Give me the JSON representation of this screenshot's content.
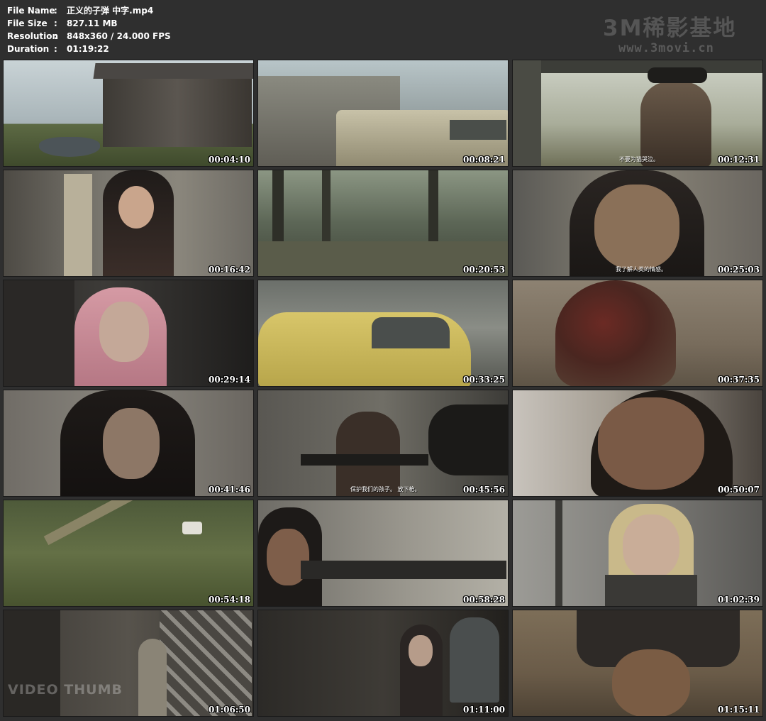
{
  "file_info": [
    {
      "label": "File Name",
      "value": "正义的子弹 中字.mp4"
    },
    {
      "label": "File Size",
      "value": "827.11 MB"
    },
    {
      "label": "Resolution",
      "value": "848x360 / 24.000 FPS"
    },
    {
      "label": "Duration",
      "value": "01:19:22"
    }
  ],
  "separator": ":",
  "watermark": {
    "title": "3M稀影基地",
    "url": "www.3movi.cn"
  },
  "thumbnails": [
    {
      "time": "00:04:10",
      "subtitle": ""
    },
    {
      "time": "00:08:21",
      "subtitle": ""
    },
    {
      "time": "00:12:31",
      "subtitle": "不要为猫哭泣。"
    },
    {
      "time": "00:16:42",
      "subtitle": ""
    },
    {
      "time": "00:20:53",
      "subtitle": ""
    },
    {
      "time": "00:25:03",
      "subtitle": "我了解人类的情感。"
    },
    {
      "time": "00:29:14",
      "subtitle": ""
    },
    {
      "time": "00:33:25",
      "subtitle": ""
    },
    {
      "time": "00:37:35",
      "subtitle": ""
    },
    {
      "time": "00:41:46",
      "subtitle": ""
    },
    {
      "time": "00:45:56",
      "subtitle": "保护我们的孩子。 放下枪。"
    },
    {
      "time": "00:50:07",
      "subtitle": ""
    },
    {
      "time": "00:54:18",
      "subtitle": ""
    },
    {
      "time": "00:58:28",
      "subtitle": ""
    },
    {
      "time": "01:02:39",
      "subtitle": ""
    },
    {
      "time": "01:06:50",
      "subtitle": ""
    },
    {
      "time": "01:11:00",
      "subtitle": ""
    },
    {
      "time": "01:15:11",
      "subtitle": ""
    }
  ],
  "overlay_text": "VIDEO THUMB",
  "colors": {
    "background": "#2f2f2f",
    "text": "#ffffff",
    "watermark": "#555555"
  }
}
